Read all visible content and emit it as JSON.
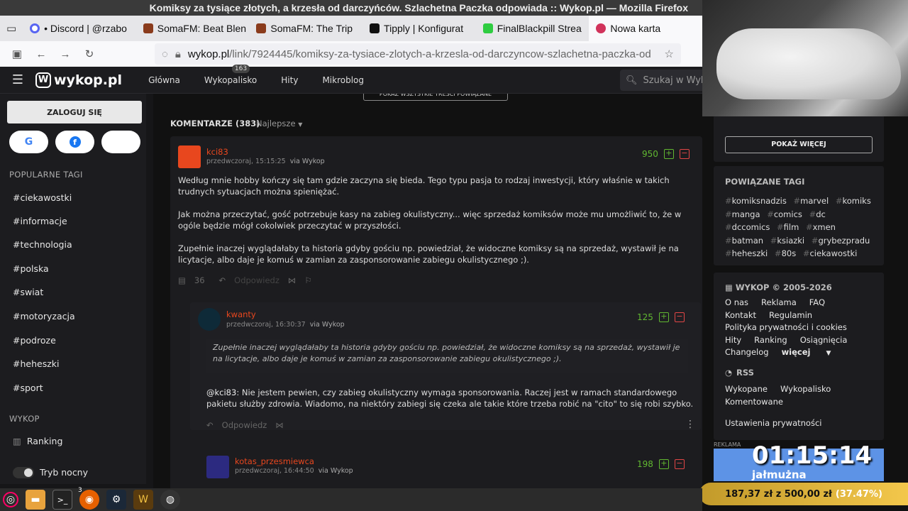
{
  "window": {
    "title": "Komiksy za tysiące złotych, a krzesła od darczyńców. Szlachetna Paczka odpowiada :: Wykop.pl — Mozilla Firefox"
  },
  "tabs": [
    {
      "label": "• Discord | @rzabo",
      "color": "#5865f2"
    },
    {
      "label": "SomaFM: Beat Blen",
      "color": "#8a3b1c"
    },
    {
      "label": "SomaFM: The Trip",
      "color": "#8a3b1c"
    },
    {
      "label": "Tipply | Konfigurat",
      "color": "#111111"
    },
    {
      "label": "FinalBlackpill Strea",
      "color": "#2ecc40"
    },
    {
      "label": "Nowa karta",
      "color": "#d1335b"
    }
  ],
  "url": {
    "host": "wykop.pl",
    "path": "/link/7924445/komiksy-za-tysiace-zlotych-a-krzesla-od-darczyncow-szlachetna-paczka-od"
  },
  "header": {
    "logo": "wykop.pl",
    "nav": [
      "Główna",
      "Wykopalisko",
      "Hity",
      "Mikroblog"
    ],
    "wykopalisko_badge": "163",
    "search_placeholder": "Szukaj w Wykop"
  },
  "left": {
    "login": "ZALOGUJ SIĘ",
    "social": [
      "G",
      "f",
      ""
    ],
    "popular_tags_title": "POPULARNE TAGI",
    "tags": [
      "#ciekawostki",
      "#informacje",
      "#technologia",
      "#polska",
      "#swiat",
      "#motoryzacja",
      "#podroze",
      "#heheszki",
      "#sport"
    ],
    "wykop_title": "WYKOP",
    "ranking": "Ranking",
    "night_mode": "Tryb nocny"
  },
  "main": {
    "show_all": "POKAŻ WSZYSTKIE TREŚCI POWIĄZANE",
    "comments_title": "KOMENTARZE (383)",
    "sort": "Najlepsze",
    "comment1": {
      "user": "kci83",
      "date": "przedwczoraj, 15:15:25",
      "via": "via",
      "source": "Wykop",
      "votes": "950",
      "p1": "Według mnie hobby kończy się tam gdzie zaczyna się bieda. Tego typu pasja to rodzaj inwestycji, który właśnie w takich trudnych sytuacjach można spieniężać.",
      "p2": "Jak można przeczytać, gość potrzebuje kasy na zabieg okulistyczny... więc sprzedaż komiksów może mu umożliwić to, że w ogóle będzie mógł cokolwiek przeczytać w przyszłości.",
      "p3": "Zupełnie inaczej wyglądałaby ta historia gdyby gościu np. powiedział, że widoczne komiksy są na sprzedaż, wystawił je na licytacje, albo daje je komuś w zamian za zasponsorowanie zabiegu okulistycznego ;).",
      "reply_count": "36",
      "reply": "Odpowiedz"
    },
    "comment2": {
      "user": "kwanty",
      "date": "przedwczoraj, 16:30:37",
      "via": "via",
      "source": "Wykop",
      "votes": "125",
      "quote": "Zupełnie inaczej wyglądałaby ta historia gdyby gościu np. powiedział, że widoczne komiksy są na sprzedaż, wystawił je na licytacje, albo daje je komuś w zamian za zasponsorowanie zabiegu okulistycznego ;).",
      "mention": "@kci83",
      "text": ": Nie jestem pewien, czy zabieg okulistyczny wymaga sponsorowania. Raczej jest w ramach standardowego pakietu służby zdrowia. Wiadomo, na niektóry zabiegi się czeka ale takie które trzeba robić na \"cito\" to się robi szybko.",
      "reply": "Odpowiedz"
    },
    "comment3": {
      "user": "kotas_przesmiewca",
      "date": "przedwczoraj, 16:44:50",
      "via": "via",
      "source": "Wykop",
      "votes": "198"
    }
  },
  "right": {
    "show_more": "POKAŻ WIĘCEJ",
    "related_tags_title": "POWIĄZANE TAGI",
    "related_tags": [
      "komiksnadzis",
      "marvel",
      "komiks",
      "manga",
      "comics",
      "dc",
      "dccomics",
      "film",
      "xmen",
      "batman",
      "ksiazki",
      "grybezpradu",
      "heheszki",
      "80s",
      "ciekawostki"
    ],
    "copyright": "WYKOP © 2005-2026",
    "links_row1": [
      "O nas",
      "Reklama",
      "FAQ"
    ],
    "links_row2": [
      "Kontakt",
      "Regulamin"
    ],
    "links_row3": [
      "Polityka prywatności i cookies"
    ],
    "links_row4": [
      "Hity",
      "Ranking",
      "Osiągnięcia"
    ],
    "links_row5": [
      "Changelog",
      "więcej"
    ],
    "rss": "RSS",
    "rss_row1": [
      "Wykopane",
      "Wykopalisko"
    ],
    "rss_row2": [
      "Komentowane"
    ],
    "privacy": "Ustawienia prywatności",
    "reklama": "REKLAMA"
  },
  "overlay": {
    "timer": "01:15:14",
    "esky_label": "jałmużna",
    "donation_amount": "187,37 zł",
    "donation_of": "z",
    "donation_goal": "500,00 zł",
    "donation_pct": "(37.47%)"
  },
  "taskbar": {
    "badge": "3"
  }
}
